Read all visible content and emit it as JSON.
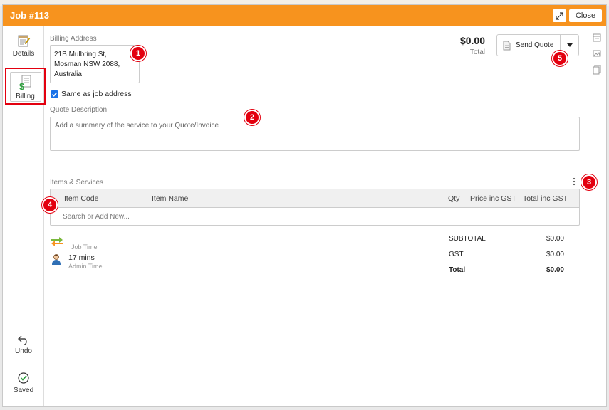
{
  "window": {
    "title": "Job #113",
    "close_label": "Close"
  },
  "nav": {
    "details_label": "Details",
    "billing_label": "Billing",
    "undo_label": "Undo",
    "saved_label": "Saved"
  },
  "billing": {
    "address_label": "Billing Address",
    "address_line1": "21B Mulbring St,",
    "address_line2": "Mosman NSW 2088,",
    "address_line3": "Australia",
    "same_as_job_label": "Same as job address",
    "same_as_job_checked": true
  },
  "summary": {
    "total_amount": "$0.00",
    "total_label": "Total"
  },
  "send_quote": {
    "label": "Send Quote"
  },
  "quote": {
    "description_label": "Quote Description",
    "description_placeholder": "Add a summary of the service to your Quote/Invoice"
  },
  "items": {
    "section_label": "Items & Services",
    "columns": [
      "Item Code",
      "Item Name",
      "Qty",
      "Price inc GST",
      "Total inc GST"
    ],
    "search_placeholder": "Search or Add New..."
  },
  "time": {
    "job_time_label": "Job Time",
    "admin_time_value": "17 mins",
    "admin_time_label": "Admin Time"
  },
  "totals": {
    "subtotal_label": "SUBTOTAL",
    "subtotal_value": "$0.00",
    "gst_label": "GST",
    "gst_value": "$0.00",
    "total_label": "Total",
    "total_value": "$0.00"
  },
  "callouts": [
    "1",
    "2",
    "3",
    "4",
    "5"
  ],
  "colors": {
    "header": "#f7931e",
    "callout": "#e3000f",
    "checkbox": "#1a73e8"
  }
}
